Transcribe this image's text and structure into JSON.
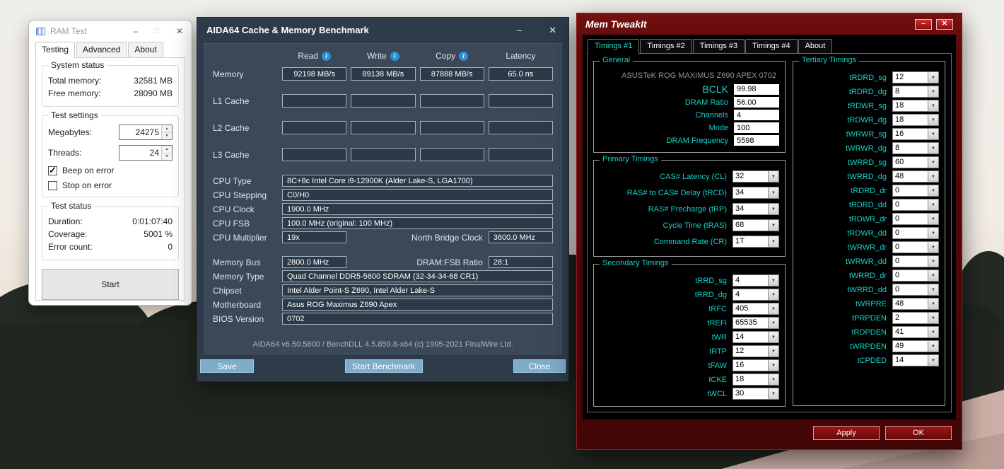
{
  "icons": {
    "minimize": "–",
    "maximize": "□",
    "close": "✕",
    "info_glyph": "i",
    "arrow_down": "▼",
    "spin_up": "▲",
    "spin_down": "▼"
  },
  "ramtest": {
    "title": "RAM Test",
    "tabs": [
      {
        "label": "Testing",
        "active": true
      },
      {
        "label": "Advanced",
        "active": false
      },
      {
        "label": "About",
        "active": false
      }
    ],
    "system_status": {
      "label": "System status",
      "rows": [
        {
          "label": "Total memory:",
          "value": "32581 MB"
        },
        {
          "label": "Free memory:",
          "value": "28090 MB"
        }
      ]
    },
    "test_settings": {
      "label": "Test settings",
      "megabytes_label": "Megabytes:",
      "megabytes_value": "24275",
      "threads_label": "Threads:",
      "threads_value": "24",
      "beep_on_error": {
        "label": "Beep on error",
        "checked": true
      },
      "stop_on_error": {
        "label": "Stop on error",
        "checked": false
      }
    },
    "test_status": {
      "label": "Test status",
      "rows": [
        {
          "label": "Duration:",
          "value": "0:01:07:40"
        },
        {
          "label": "Coverage:",
          "value": "5001 %"
        },
        {
          "label": "Error count:",
          "value": "0"
        }
      ]
    },
    "start_button": "Start"
  },
  "aida64": {
    "title": "AIDA64 Cache & Memory Benchmark",
    "columns": [
      {
        "label": "Read",
        "info": true
      },
      {
        "label": "Write",
        "info": true
      },
      {
        "label": "Copy",
        "info": true
      },
      {
        "label": "Latency",
        "info": false
      }
    ],
    "bench_rows": [
      {
        "label": "Memory",
        "values": [
          "92198 MB/s",
          "89138 MB/s",
          "87888 MB/s",
          "65.0 ns"
        ]
      },
      {
        "label": "L1 Cache",
        "values": [
          "",
          "",
          "",
          ""
        ]
      },
      {
        "label": "L2 Cache",
        "values": [
          "",
          "",
          "",
          ""
        ]
      },
      {
        "label": "L3 Cache",
        "values": [
          "",
          "",
          "",
          ""
        ]
      }
    ],
    "info_rows": [
      {
        "label": "CPU Type",
        "value": "8C+8c Intel Core i9-12900K  (Alder Lake-S, LGA1700)"
      },
      {
        "label": "CPU Stepping",
        "value": "C0/H0"
      },
      {
        "label": "CPU Clock",
        "value": "1900.0 MHz"
      },
      {
        "label": "CPU FSB",
        "value": "100.0 MHz  (original: 100 MHz)"
      },
      {
        "label": "CPU Multiplier",
        "value": "19x",
        "label2": "North Bridge Clock",
        "value2": "3600.0 MHz"
      },
      {
        "label": "Memory Bus",
        "value": "2800.0 MHz",
        "label2": "DRAM:FSB Ratio",
        "value2": "28:1",
        "gap_before": true
      },
      {
        "label": "Memory Type",
        "value": "Quad Channel DDR5-5600 SDRAM  (32-34-34-68 CR1)"
      },
      {
        "label": "Chipset",
        "value": "Intel Alder Point-S Z690, Intel Alder Lake-S"
      },
      {
        "label": "Motherboard",
        "value": "Asus ROG Maximus Z690 Apex"
      },
      {
        "label": "BIOS Version",
        "value": "0702"
      }
    ],
    "footer": "AIDA64 v6.50.5800 / BenchDLL 4.5.859.8-x64  (c) 1995-2021 FinalWire Ltd.",
    "buttons": {
      "save": "Save",
      "start": "Start Benchmark",
      "close": "Close"
    }
  },
  "memtweakit": {
    "title": "Mem TweakIt",
    "tabs": [
      {
        "label": "Timings #1",
        "active": true
      },
      {
        "label": "Timings #2",
        "active": false
      },
      {
        "label": "Timings #3",
        "active": false
      },
      {
        "label": "Timings #4",
        "active": false
      },
      {
        "label": "About",
        "active": false
      }
    ],
    "general": {
      "label": "General",
      "board": "ASUSTeK ROG MAXIMUS Z690 APEX 0702",
      "fields": [
        {
          "label": "BCLK",
          "value": "99.98",
          "big": true
        },
        {
          "label": "DRAM Ratio",
          "value": "56.00"
        },
        {
          "label": "Channels",
          "value": "4"
        },
        {
          "label": "Mode",
          "value": "100"
        },
        {
          "label": "DRAM Frequency",
          "value": "5598"
        }
      ]
    },
    "primary": {
      "label": "Primary Timings",
      "rows": [
        {
          "label": "CAS# Latency (CL)",
          "value": "32"
        },
        {
          "label": "RAS# to CAS# Delay (tRCD)",
          "value": "34"
        },
        {
          "label": "RAS# Precharge (tRP)",
          "value": "34"
        },
        {
          "label": "Cycle Time (tRAS)",
          "value": "68"
        },
        {
          "label": "Command Rate (CR)",
          "value": "1T"
        }
      ]
    },
    "secondary": {
      "label": "Secondary Timings",
      "rows": [
        {
          "label": "tRRD_sg",
          "value": "4"
        },
        {
          "label": "tRRD_dg",
          "value": "4"
        },
        {
          "label": "tRFC",
          "value": "405"
        },
        {
          "label": "tREFi",
          "value": "65535"
        },
        {
          "label": "tWR",
          "value": "14"
        },
        {
          "label": "tRTP",
          "value": "12"
        },
        {
          "label": "tFAW",
          "value": "16"
        },
        {
          "label": "tCKE",
          "value": "18"
        },
        {
          "label": "tWCL",
          "value": "30"
        }
      ]
    },
    "tertiary": {
      "label": "Tertiary Timings",
      "rows": [
        {
          "label": "tRDRD_sg",
          "value": "12"
        },
        {
          "label": "tRDRD_dg",
          "value": "8"
        },
        {
          "label": "tRDWR_sg",
          "value": "18"
        },
        {
          "label": "tRDWR_dg",
          "value": "18"
        },
        {
          "label": "tWRWR_sg",
          "value": "16"
        },
        {
          "label": "tWRWR_dg",
          "value": "8"
        },
        {
          "label": "tWRRD_sg",
          "value": "60"
        },
        {
          "label": "tWRRD_dg",
          "value": "48"
        },
        {
          "label": "tRDRD_dr",
          "value": "0"
        },
        {
          "label": "tRDRD_dd",
          "value": "0"
        },
        {
          "label": "tRDWR_dr",
          "value": "0"
        },
        {
          "label": "tRDWR_dd",
          "value": "0"
        },
        {
          "label": "tWRWR_dr",
          "value": "0"
        },
        {
          "label": "tWRWR_dd",
          "value": "0"
        },
        {
          "label": "tWRRD_dr",
          "value": "0"
        },
        {
          "label": "tWRRD_dd",
          "value": "0"
        },
        {
          "label": "tWRPRE",
          "value": "48"
        },
        {
          "label": "tPRPDEN",
          "value": "2"
        },
        {
          "label": "tRDPDEN",
          "value": "41"
        },
        {
          "label": "tWRPDEN",
          "value": "49"
        },
        {
          "label": "tCPDED",
          "value": "14"
        }
      ]
    },
    "buttons": {
      "apply": "Apply",
      "ok": "OK"
    }
  }
}
